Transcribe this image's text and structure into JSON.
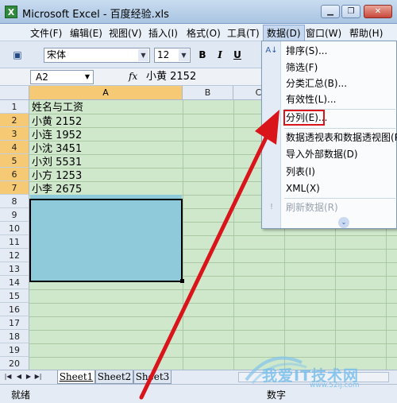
{
  "window": {
    "title": "Microsoft Excel - 百度经验.xls",
    "icon_label": "X"
  },
  "menubar": {
    "items": [
      "文件(F)",
      "编辑(E)",
      "视图(V)",
      "插入(I)",
      "格式(O)",
      "工具(T)",
      "数据(D)",
      "窗口(W)",
      "帮助(H)"
    ]
  },
  "toolbar": {
    "font_name": "宋体",
    "font_size": "12",
    "bold_label": "B",
    "italic_label": "I",
    "underline_label": "U"
  },
  "formula_bar": {
    "name_box": "A2",
    "fx_label": "fx",
    "content": "小黄  2152"
  },
  "grid": {
    "columns": [
      "A",
      "B",
      "C"
    ],
    "rows": [
      "1",
      "2",
      "3",
      "4",
      "5",
      "6",
      "7",
      "8",
      "9",
      "10",
      "11",
      "12",
      "13",
      "14",
      "15",
      "16",
      "17",
      "18",
      "19",
      "20",
      "21",
      "22"
    ],
    "cells": [
      "姓名与工资",
      "小黄  2152",
      "小连  1952",
      "小沈  3451",
      "小刘  5531",
      "小方  1253",
      "小李  2675"
    ]
  },
  "data_menu": {
    "items": [
      {
        "label": "排序(S)...",
        "icon": "sort-icon",
        "enabled": true
      },
      {
        "label": "筛选(F)",
        "enabled": true
      },
      {
        "label": "分类汇总(B)...",
        "enabled": true
      },
      {
        "label": "有效性(L)...",
        "enabled": true
      },
      {
        "label": "分列(E)...",
        "enabled": true,
        "highlighted": true
      },
      {
        "label": "数据透视表和数据透视图(P)...",
        "icon": "pivot-table-icon",
        "enabled": true
      },
      {
        "label": "导入外部数据(D)",
        "enabled": true
      },
      {
        "label": "列表(I)",
        "enabled": true
      },
      {
        "label": "XML(X)",
        "enabled": true
      },
      {
        "label": "刷新数据(R)",
        "icon": "refresh-icon",
        "enabled": false
      }
    ],
    "expand_icon": "double-chevron-down-icon"
  },
  "sheets": [
    "Sheet1",
    "Sheet2",
    "Sheet3"
  ],
  "active_sheet": "Sheet1",
  "status": {
    "left": "就绪",
    "right": "数字"
  },
  "watermark": {
    "text": "我爱IT技术网",
    "url": "www.52ij.com"
  },
  "colors": {
    "selection_fill": "#8fcadb",
    "grid_background": "#cfe8cb",
    "highlight_box": "#d9141a",
    "arrow": "#d9141a"
  }
}
